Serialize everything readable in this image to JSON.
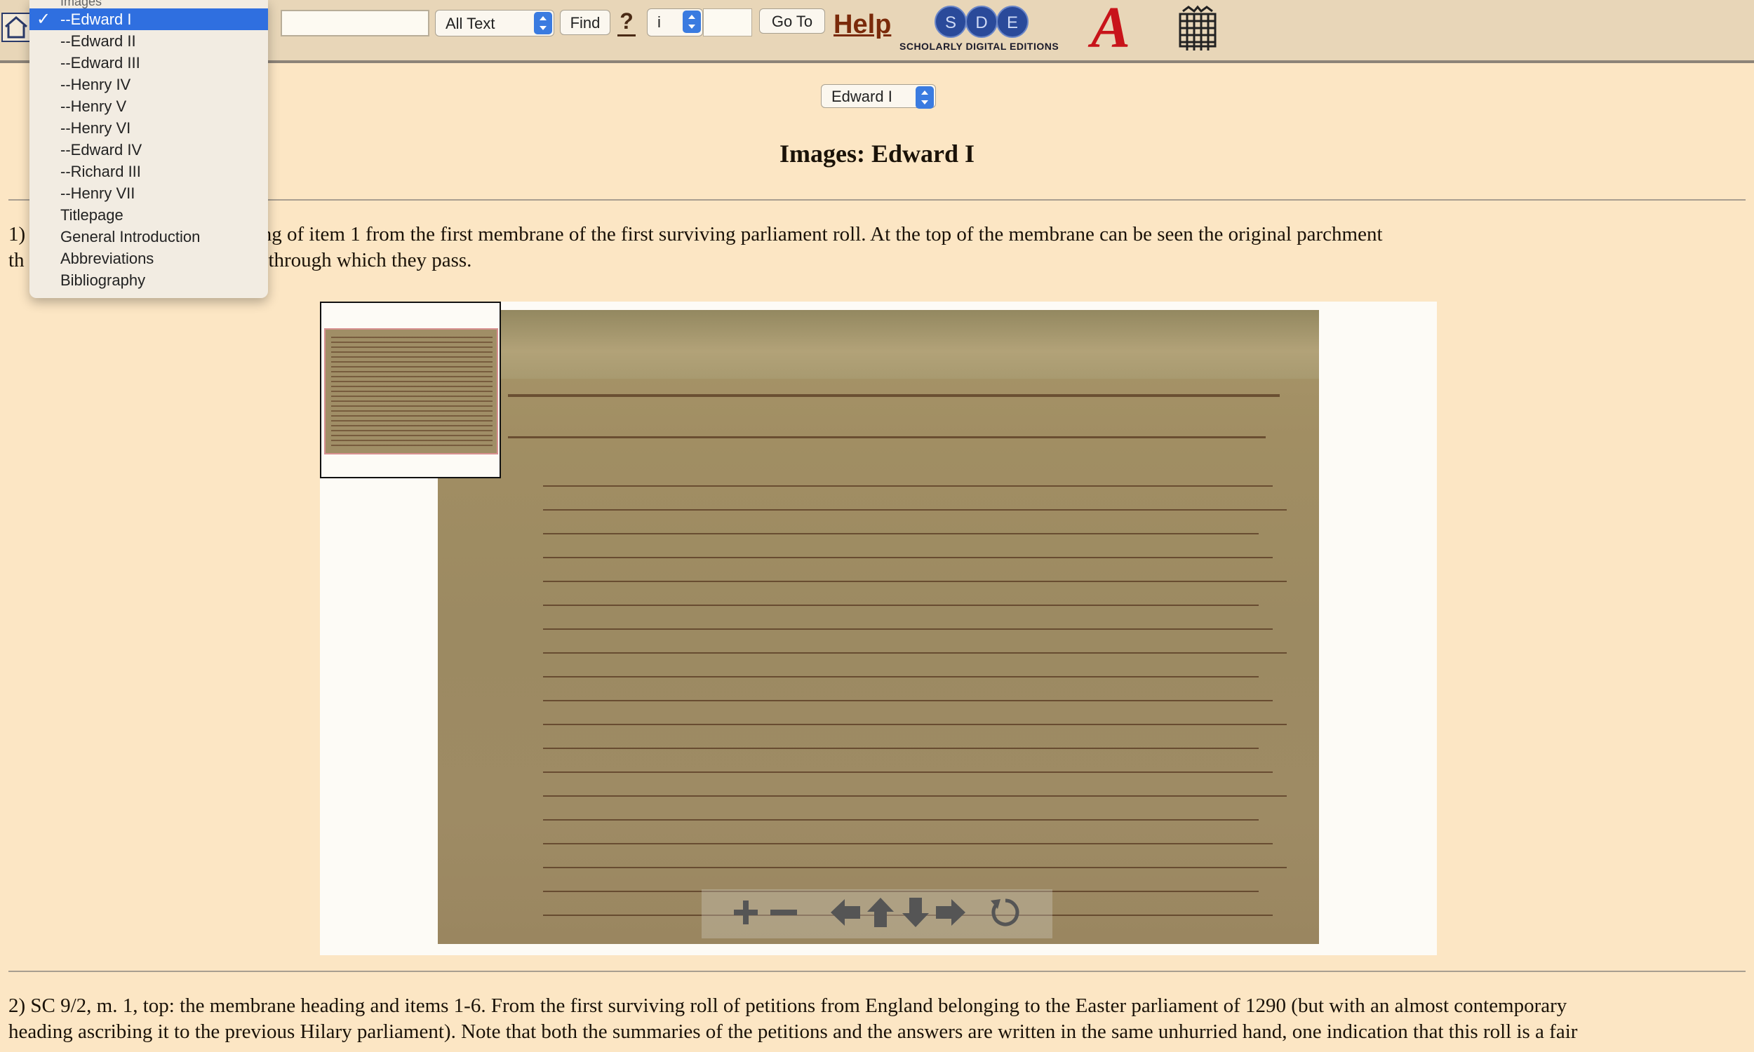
{
  "toolbar": {
    "search_value": "",
    "search_scope": "All Text",
    "find_label": "Find",
    "help_q": "?",
    "page_type": "i",
    "page_value": "",
    "goto_label": "Go To",
    "help_label": "Help",
    "sde_letters": [
      "S",
      "D",
      "E"
    ],
    "sde_caption": "SCHOLARLY DIGITAL EDITIONS",
    "a_logo": "A"
  },
  "dropdown": {
    "header": "Images",
    "check_mark": "✓",
    "items": [
      {
        "label": "--Edward I",
        "selected": true
      },
      {
        "label": "--Edward II"
      },
      {
        "label": "--Edward III"
      },
      {
        "label": "--Henry IV"
      },
      {
        "label": "--Henry V"
      },
      {
        "label": "--Henry VI"
      },
      {
        "label": "--Edward IV"
      },
      {
        "label": "--Richard III"
      },
      {
        "label": "--Henry VII"
      },
      {
        "label": "Titlepage"
      },
      {
        "label": "General Introduction"
      },
      {
        "label": "Abbreviations"
      },
      {
        "label": "Bibliography"
      }
    ]
  },
  "main": {
    "section_select": "Edward I",
    "title": "Images: Edward I",
    "caption1_line1": "1)                                        mbrane heading and beginning of item 1 from the first membrane of the first surviving parliament roll. At the top of the membrane can be seen the original parchment",
    "caption1_line2": "th                                        anes of the roll and the holes through which they pass.",
    "caption2_line1": "2) SC 9/2, m. 1, top: the membrane heading and items 1-6. From the first surviving roll of petitions from England belonging to the Easter parliament of 1290 (but with an almost contemporary",
    "caption2_line2": "heading ascribing it to the previous Hilary parliament). Note that both the summaries of the petitions and the answers are written in the same unhurried hand, one indication that this roll is a fair"
  }
}
